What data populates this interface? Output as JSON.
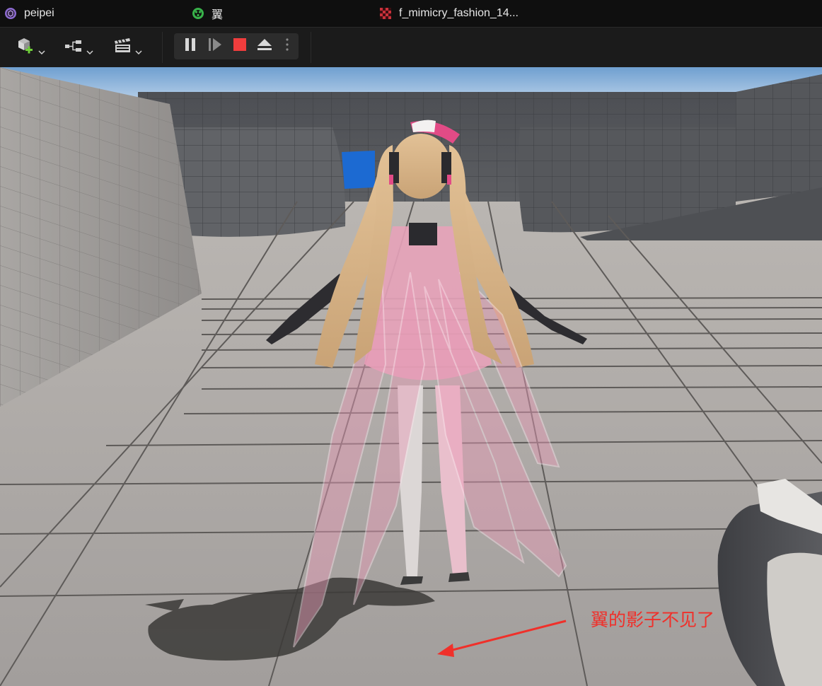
{
  "tabs": [
    {
      "label": "peipei",
      "icon": "unreal-project-icon",
      "color": "#8d6bd1"
    },
    {
      "label": "翼",
      "icon": "blueprint-level-icon",
      "color": "#38b24a"
    },
    {
      "label": "f_mimicry_fashion_14...",
      "icon": "material-checker-icon",
      "color": "#c9303a"
    }
  ],
  "toolbar": {
    "buttons": [
      {
        "name": "add-actor-button",
        "icon": "cube-plus-icon"
      },
      {
        "name": "blueprint-menu-button",
        "icon": "blueprint-graph-icon"
      },
      {
        "name": "cinematics-button",
        "icon": "clapperboard-icon"
      }
    ],
    "play_controls": [
      {
        "name": "pause-button",
        "icon": "pause-icon"
      },
      {
        "name": "step-frame-button",
        "icon": "step-forward-icon"
      },
      {
        "name": "stop-button",
        "icon": "stop-icon",
        "color": "#f03d3d"
      },
      {
        "name": "eject-button",
        "icon": "eject-icon"
      },
      {
        "name": "more-options-button",
        "icon": "kebab-icon"
      }
    ]
  },
  "viewport": {
    "scene": "game-viewport-character-with-wings",
    "colors": {
      "sky": "#9fc0e0",
      "floor": "#a29e9c",
      "wall": "#4a4c50",
      "wing": "#e99ab6",
      "shadow": "#3a3836",
      "blue_block": "#1c6ad2"
    }
  },
  "annotation": {
    "text": "翼的影子不见了",
    "color": "#f0302a"
  }
}
